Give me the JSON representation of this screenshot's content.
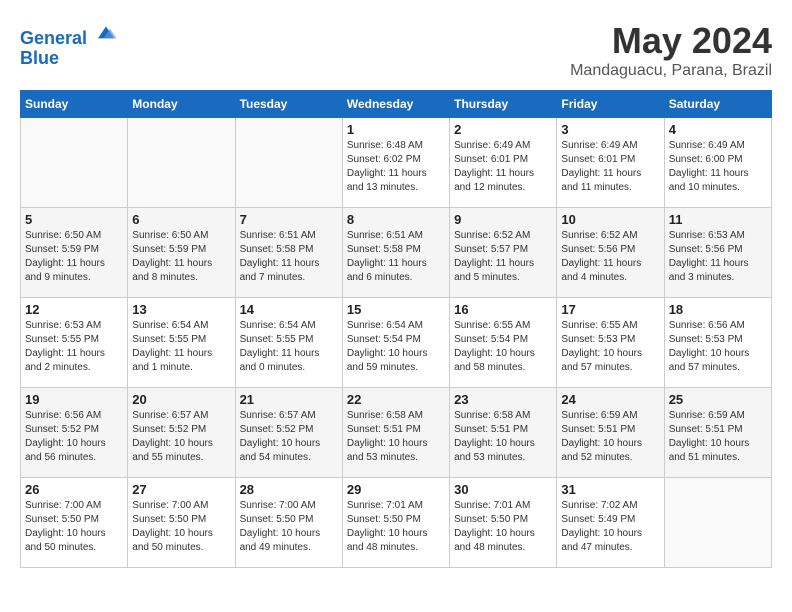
{
  "header": {
    "logo_line1": "General",
    "logo_line2": "Blue",
    "month_year": "May 2024",
    "location": "Mandaguacu, Parana, Brazil"
  },
  "weekdays": [
    "Sunday",
    "Monday",
    "Tuesday",
    "Wednesday",
    "Thursday",
    "Friday",
    "Saturday"
  ],
  "weeks": [
    [
      {
        "day": "",
        "info": ""
      },
      {
        "day": "",
        "info": ""
      },
      {
        "day": "",
        "info": ""
      },
      {
        "day": "1",
        "info": "Sunrise: 6:48 AM\nSunset: 6:02 PM\nDaylight: 11 hours\nand 13 minutes."
      },
      {
        "day": "2",
        "info": "Sunrise: 6:49 AM\nSunset: 6:01 PM\nDaylight: 11 hours\nand 12 minutes."
      },
      {
        "day": "3",
        "info": "Sunrise: 6:49 AM\nSunset: 6:01 PM\nDaylight: 11 hours\nand 11 minutes."
      },
      {
        "day": "4",
        "info": "Sunrise: 6:49 AM\nSunset: 6:00 PM\nDaylight: 11 hours\nand 10 minutes."
      }
    ],
    [
      {
        "day": "5",
        "info": "Sunrise: 6:50 AM\nSunset: 5:59 PM\nDaylight: 11 hours\nand 9 minutes."
      },
      {
        "day": "6",
        "info": "Sunrise: 6:50 AM\nSunset: 5:59 PM\nDaylight: 11 hours\nand 8 minutes."
      },
      {
        "day": "7",
        "info": "Sunrise: 6:51 AM\nSunset: 5:58 PM\nDaylight: 11 hours\nand 7 minutes."
      },
      {
        "day": "8",
        "info": "Sunrise: 6:51 AM\nSunset: 5:58 PM\nDaylight: 11 hours\nand 6 minutes."
      },
      {
        "day": "9",
        "info": "Sunrise: 6:52 AM\nSunset: 5:57 PM\nDaylight: 11 hours\nand 5 minutes."
      },
      {
        "day": "10",
        "info": "Sunrise: 6:52 AM\nSunset: 5:56 PM\nDaylight: 11 hours\nand 4 minutes."
      },
      {
        "day": "11",
        "info": "Sunrise: 6:53 AM\nSunset: 5:56 PM\nDaylight: 11 hours\nand 3 minutes."
      }
    ],
    [
      {
        "day": "12",
        "info": "Sunrise: 6:53 AM\nSunset: 5:55 PM\nDaylight: 11 hours\nand 2 minutes."
      },
      {
        "day": "13",
        "info": "Sunrise: 6:54 AM\nSunset: 5:55 PM\nDaylight: 11 hours\nand 1 minute."
      },
      {
        "day": "14",
        "info": "Sunrise: 6:54 AM\nSunset: 5:55 PM\nDaylight: 11 hours\nand 0 minutes."
      },
      {
        "day": "15",
        "info": "Sunrise: 6:54 AM\nSunset: 5:54 PM\nDaylight: 10 hours\nand 59 minutes."
      },
      {
        "day": "16",
        "info": "Sunrise: 6:55 AM\nSunset: 5:54 PM\nDaylight: 10 hours\nand 58 minutes."
      },
      {
        "day": "17",
        "info": "Sunrise: 6:55 AM\nSunset: 5:53 PM\nDaylight: 10 hours\nand 57 minutes."
      },
      {
        "day": "18",
        "info": "Sunrise: 6:56 AM\nSunset: 5:53 PM\nDaylight: 10 hours\nand 57 minutes."
      }
    ],
    [
      {
        "day": "19",
        "info": "Sunrise: 6:56 AM\nSunset: 5:52 PM\nDaylight: 10 hours\nand 56 minutes."
      },
      {
        "day": "20",
        "info": "Sunrise: 6:57 AM\nSunset: 5:52 PM\nDaylight: 10 hours\nand 55 minutes."
      },
      {
        "day": "21",
        "info": "Sunrise: 6:57 AM\nSunset: 5:52 PM\nDaylight: 10 hours\nand 54 minutes."
      },
      {
        "day": "22",
        "info": "Sunrise: 6:58 AM\nSunset: 5:51 PM\nDaylight: 10 hours\nand 53 minutes."
      },
      {
        "day": "23",
        "info": "Sunrise: 6:58 AM\nSunset: 5:51 PM\nDaylight: 10 hours\nand 53 minutes."
      },
      {
        "day": "24",
        "info": "Sunrise: 6:59 AM\nSunset: 5:51 PM\nDaylight: 10 hours\nand 52 minutes."
      },
      {
        "day": "25",
        "info": "Sunrise: 6:59 AM\nSunset: 5:51 PM\nDaylight: 10 hours\nand 51 minutes."
      }
    ],
    [
      {
        "day": "26",
        "info": "Sunrise: 7:00 AM\nSunset: 5:50 PM\nDaylight: 10 hours\nand 50 minutes."
      },
      {
        "day": "27",
        "info": "Sunrise: 7:00 AM\nSunset: 5:50 PM\nDaylight: 10 hours\nand 50 minutes."
      },
      {
        "day": "28",
        "info": "Sunrise: 7:00 AM\nSunset: 5:50 PM\nDaylight: 10 hours\nand 49 minutes."
      },
      {
        "day": "29",
        "info": "Sunrise: 7:01 AM\nSunset: 5:50 PM\nDaylight: 10 hours\nand 48 minutes."
      },
      {
        "day": "30",
        "info": "Sunrise: 7:01 AM\nSunset: 5:50 PM\nDaylight: 10 hours\nand 48 minutes."
      },
      {
        "day": "31",
        "info": "Sunrise: 7:02 AM\nSunset: 5:49 PM\nDaylight: 10 hours\nand 47 minutes."
      },
      {
        "day": "",
        "info": ""
      }
    ]
  ]
}
